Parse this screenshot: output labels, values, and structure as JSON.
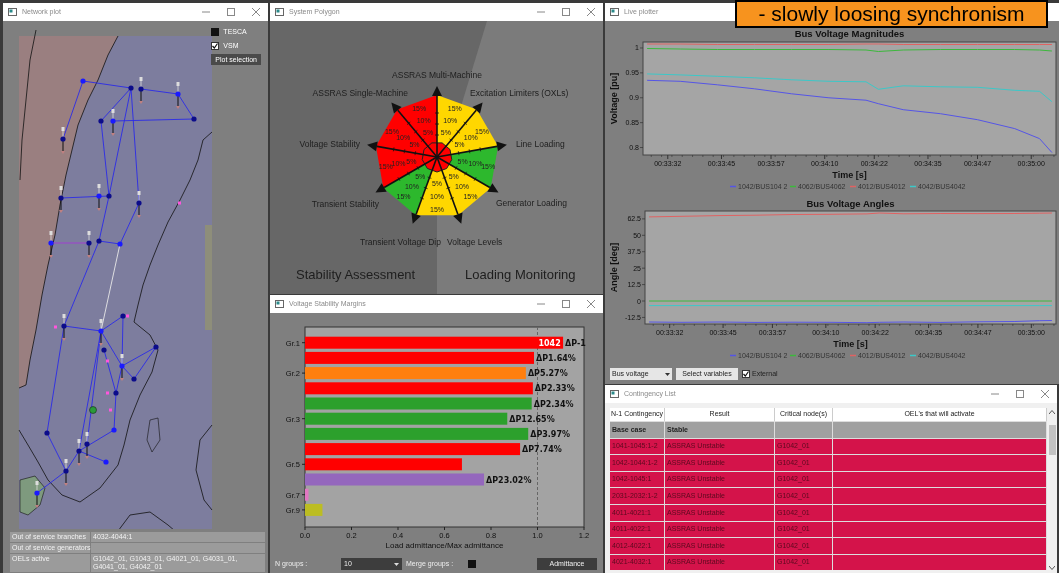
{
  "network_plot": {
    "title": "Network plot",
    "layers": [
      {
        "label": "TESCA",
        "checked": false
      },
      {
        "label": "VSM",
        "checked": true
      }
    ],
    "plot_button": "Plot selection",
    "info": [
      {
        "label": "Out of service branches",
        "value": "4032-4044:1"
      },
      {
        "label": "Out of service generators"
      },
      {
        "label": "OELs active",
        "value": "G1042_01, G1043_01, G4021_01, G4031_01, G4041_01, G4042_01"
      }
    ]
  },
  "system_polygon": {
    "title": "System Polygon",
    "sectors": [
      {
        "color": "#ff0000",
        "ticks": [
          "5%",
          "10%",
          "15%"
        ]
      },
      {
        "color": "#ffd700",
        "ticks": [
          "5%",
          "10%",
          "15%"
        ]
      },
      {
        "color": "#ff0000",
        "ticks": [
          "5%",
          "10%",
          "15%"
        ]
      },
      {
        "color": "#ffd700",
        "ticks": [
          "5%",
          "10%",
          "15%"
        ]
      },
      {
        "color": "#ff0000",
        "ticks": [
          "5%",
          "10%",
          "15%"
        ]
      },
      {
        "color": "#2db82d",
        "ticks": [
          "5%",
          "10%",
          "15%"
        ]
      },
      {
        "color": "#2db82d",
        "ticks": [
          "5%",
          "10%",
          "15%"
        ]
      },
      {
        "color": "#ffd700",
        "ticks": [
          "5%",
          "10%",
          "15%"
        ]
      },
      {
        "color": "#ffd700",
        "ticks": [
          "5%",
          "10%",
          "15%"
        ]
      }
    ],
    "axes": [
      {
        "label": "ASSRAS Multi-Machine"
      },
      {
        "label": "ASSRAS Single-Machine"
      },
      {
        "label": "Excitation Limiters (OXLs)"
      },
      {
        "label": "Voltage Stability"
      },
      {
        "label": "Line Loading"
      },
      {
        "label": "Transient Stability"
      },
      {
        "label": "Generator Loading"
      },
      {
        "label": "Transient Voltage Dip"
      },
      {
        "label": "Voltage Levels"
      }
    ],
    "regions": [
      "Stability Assessment",
      "Loading Monitoring"
    ]
  },
  "voltage_stability_margins": {
    "title": "Voltage Stability Margins",
    "chart_data": {
      "type": "bar",
      "orientation": "horizontal",
      "xlabel": "Load admittance/Max admittance",
      "xlim": [
        0,
        1.2
      ],
      "xticks": [
        {
          "value": 0,
          "label": "0.0"
        },
        {
          "value": 0.2,
          "label": "0.2"
        },
        {
          "value": 0.4,
          "label": "0.4"
        },
        {
          "value": 0.6,
          "label": "0.6"
        },
        {
          "value": 0.8,
          "label": "0.8"
        },
        {
          "value": 1,
          "label": "1.0"
        },
        {
          "value": 1.2,
          "label": "1.2"
        }
      ],
      "categories": [
        "Gr.1",
        null,
        "Gr.2",
        null,
        null,
        "Gr.3",
        null,
        null,
        "Gr.5",
        null,
        "Gr.7",
        "Gr.9"
      ],
      "values": [
        1.11,
        0.985,
        0.95,
        0.98,
        0.975,
        0.87,
        0.96,
        0.925,
        0.675,
        0.77,
        0.015,
        0.075
      ],
      "colors": [
        "#ff0000",
        "#ff0000",
        "#ff7f0e",
        "#ff0000",
        "#2ca02c",
        "#2ca02c",
        "#2ca02c",
        "#ff0000",
        "#ff0000",
        "#9467bd",
        "#e377c2",
        "#bcbd22"
      ],
      "value_labels": [
        "ΔP-1",
        "ΔP1.64%",
        "ΔP5.27%",
        "ΔP2.33%",
        "ΔP2.34%",
        "ΔP12.65%",
        "ΔP3.97%",
        "ΔP7.74%",
        null,
        "ΔP23.02%",
        null,
        null
      ],
      "annotations": [
        {
          "text": "1042",
          "x": 1.1,
          "y": "Gr.1"
        }
      ],
      "ref_lines": [
        {
          "axis": "x",
          "value": 1
        }
      ]
    },
    "controls": {
      "n_groups_label": "N groups :",
      "n_groups": "10",
      "merge_label": "Merge groups :",
      "merge_checked": false,
      "button": "Admittance"
    }
  },
  "live_plotter": {
    "title": "Live plotter",
    "banner": "- slowly loosing synchronism",
    "charts": [
      {
        "chart_data": {
          "type": "line",
          "legend": "bottom",
          "title": "Bus Voltage Magnitudes",
          "xlabel": "Time [s]",
          "ylabel": "Voltage [pu]",
          "xlim": [
            2006,
            2106
          ],
          "ylim": [
            0.785,
            1.012
          ],
          "xticks": [
            {
              "value": 2012,
              "label": "00:33:32"
            },
            {
              "value": 2025,
              "label": "00:33:45"
            },
            {
              "value": 2037,
              "label": "00:33:57"
            },
            {
              "value": 2050,
              "label": "00:34:10"
            },
            {
              "value": 2062,
              "label": "00:34:22"
            },
            {
              "value": 2075,
              "label": "00:34:35"
            },
            {
              "value": 2087,
              "label": "00:34:47"
            },
            {
              "value": 2100,
              "label": "00:35:00"
            }
          ],
          "yticks": [
            {
              "value": 0.8,
              "label": "0.8"
            },
            {
              "value": 0.85,
              "label": "0.85"
            },
            {
              "value": 0.9,
              "label": "0.9"
            },
            {
              "value": 0.95,
              "label": "0.95"
            },
            {
              "value": 1,
              "label": "1"
            }
          ],
          "x": [
            2007,
            2015,
            2024,
            2033,
            2042,
            2051,
            2060,
            2063,
            2069,
            2078,
            2087,
            2096,
            2102,
            2105
          ],
          "series": [
            {
              "name": "1042/BUS104 2",
              "color": "#5555e6",
              "values": [
                0.935,
                0.933,
                0.926,
                0.918,
                0.908,
                0.9,
                0.895,
                0.888,
                0.876,
                0.868,
                0.856,
                0.838,
                0.818,
                0.79
              ]
            },
            {
              "name": "4062/BUS4062",
              "color": "#3cb83c",
              "values": [
                0.999,
                0.998,
                0.997,
                0.997,
                0.997,
                0.997,
                0.996,
                0.993,
                0.996,
                0.997,
                0.997,
                0.997,
                0.996,
                0.994
              ]
            },
            {
              "name": "4012/BUS4012",
              "color": "#e06262",
              "values": [
                1.008,
                1.008,
                1.007,
                1.007,
                1.007,
                1.007,
                1.008,
                1.008,
                1.007,
                1.007,
                1.007,
                1.007,
                1.007,
                1.007
              ]
            },
            {
              "name": "4042/BUS4042",
              "color": "#3cc8c8",
              "values": [
                0.948,
                0.946,
                0.943,
                0.94,
                0.936,
                0.933,
                0.932,
                0.917,
                0.924,
                0.922,
                0.921,
                0.915,
                0.913,
                0.892
              ]
            }
          ]
        }
      },
      {
        "chart_data": {
          "type": "line",
          "legend": "bottom",
          "title": "Bus Voltage Angles",
          "xlabel": "Time [s]",
          "ylabel": "Angle [deg]",
          "xlim": [
            2006,
            2106
          ],
          "ylim": [
            -17.5,
            68.5
          ],
          "xticks": [
            {
              "value": 2012,
              "label": "00:33:32"
            },
            {
              "value": 2025,
              "label": "00:33:45"
            },
            {
              "value": 2037,
              "label": "00:33:57"
            },
            {
              "value": 2050,
              "label": "00:34:10"
            },
            {
              "value": 2062,
              "label": "00:34:22"
            },
            {
              "value": 2075,
              "label": "00:34:35"
            },
            {
              "value": 2087,
              "label": "00:34:47"
            },
            {
              "value": 2100,
              "label": "00:35:00"
            }
          ],
          "yticks": [
            -12.5,
            0,
            12.5,
            25,
            37.5,
            50,
            62.5
          ],
          "x": [
            2007,
            2015,
            2024,
            2033,
            2042,
            2051,
            2060,
            2063,
            2069,
            2078,
            2087,
            2096,
            2102,
            2105
          ],
          "series": [
            {
              "name": "1042/BUS104 2",
              "color": "#5555e6",
              "values": [
                -16,
                -16.2,
                -16,
                -16.3,
                -16.1,
                -16.2,
                -16.5,
                -16.2,
                -16,
                -16.3,
                -15.8,
                -15.6,
                -15,
                -14.8
              ]
            },
            {
              "name": "4062/BUS4062",
              "color": "#3cb83c",
              "values": [
                0,
                0,
                0,
                0,
                0,
                0,
                0,
                0,
                0,
                0,
                0,
                0,
                0,
                0
              ]
            },
            {
              "name": "4012/BUS4012",
              "color": "#e06262",
              "values": [
                64,
                64.5,
                65,
                65.3,
                65.8,
                66,
                66.3,
                67,
                66.4,
                66.6,
                66.5,
                66.6,
                66.8,
                67
              ]
            },
            {
              "name": "4042/BUS4042",
              "color": "#3cc8c8",
              "values": [
                -3.5,
                -3.5,
                -3.5,
                -3.5,
                -3.5,
                -3.5,
                -3.5,
                -3.5,
                -3.5,
                -3.5,
                -3.5,
                -3.5,
                -3.5,
                -3.5
              ]
            }
          ]
        }
      }
    ],
    "controls": {
      "variable_type": "Bus voltage",
      "select_button": "Select variables",
      "external": {
        "label": "External",
        "checked": true
      }
    }
  },
  "contingency_list": {
    "title": "Contingency List",
    "columns": [
      "N-1 Contingency",
      "Result",
      "Critical node(s)",
      "OEL's that will activate"
    ],
    "rows": [
      {
        "contingency": "Base case",
        "result": "Stable",
        "color": "#a0a0a0"
      },
      {
        "contingency": "1041-1045:1-2",
        "result": "ASSRAS Unstable",
        "critical_node": "G1042_01",
        "color": "#d4134a"
      },
      {
        "contingency": "1042-1044:1-2",
        "result": "ASSRAS Unstable",
        "critical_node": "G1042_01",
        "color": "#d4134a"
      },
      {
        "contingency": "1042-1045:1",
        "result": "ASSRAS Unstable",
        "critical_node": "G1042_01",
        "color": "#d4134a"
      },
      {
        "contingency": "2031-2032:1-2",
        "result": "ASSRAS Unstable",
        "critical_node": "G1042_01",
        "color": "#d4134a"
      },
      {
        "contingency": "4011-4021:1",
        "result": "ASSRAS Unstable",
        "critical_node": "G1042_01",
        "color": "#d4134a"
      },
      {
        "contingency": "4011-4022:1",
        "result": "ASSRAS Unstable",
        "critical_node": "G1042_01",
        "color": "#d4134a"
      },
      {
        "contingency": "4012-4022:1",
        "result": "ASSRAS Unstable",
        "critical_node": "G1042_01",
        "color": "#d4134a"
      },
      {
        "contingency": "4021-4032:1",
        "result": "ASSRAS Unstable",
        "critical_node": "G1042_01",
        "color": "#d4134a"
      }
    ]
  }
}
